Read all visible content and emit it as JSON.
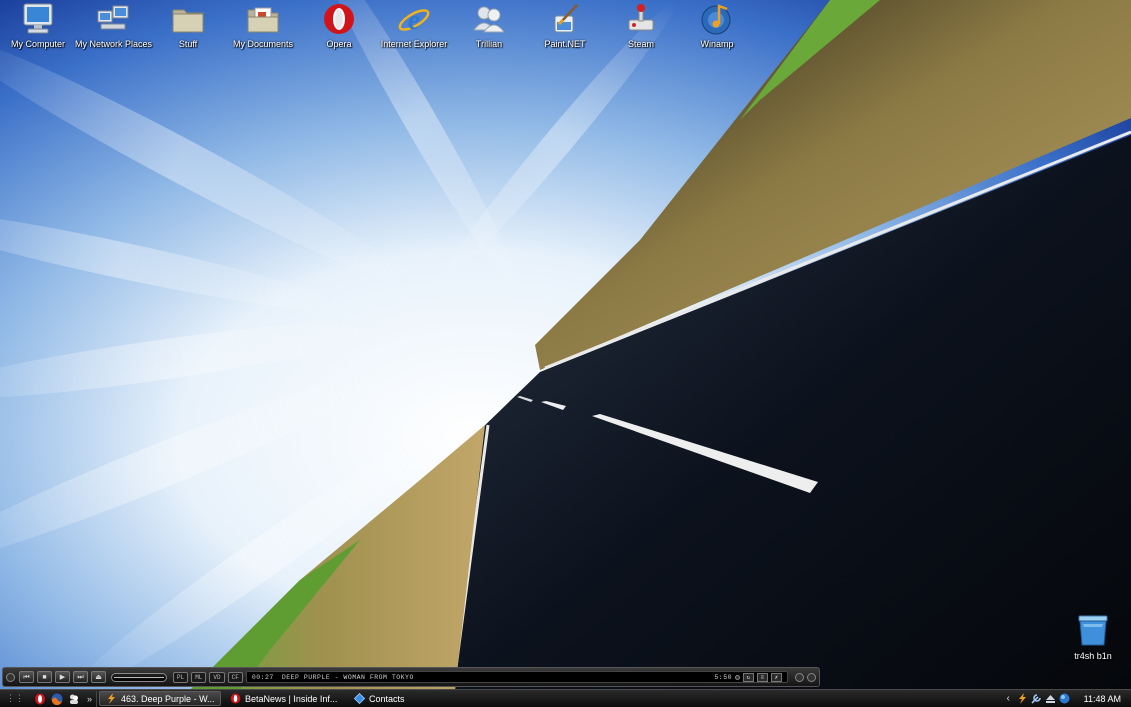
{
  "desktop": {
    "icons": [
      {
        "label": "My Computer"
      },
      {
        "label": "My Network Places"
      },
      {
        "label": "Stuff"
      },
      {
        "label": "My Documents"
      },
      {
        "label": "Opera"
      },
      {
        "label": "Internet Explorer"
      },
      {
        "label": "Trillian"
      },
      {
        "label": "Paint.NET"
      },
      {
        "label": "Steam"
      },
      {
        "label": "Winamp"
      }
    ],
    "trash": {
      "label": "tr4sh b1n"
    }
  },
  "winamp": {
    "buttons": [
      "prev",
      "play",
      "pause",
      "stop",
      "next",
      "eject"
    ],
    "tags": [
      "PL",
      "ML",
      "VD",
      "CF"
    ],
    "time": "00:27",
    "track": "DEEP PURPLE - WOMAN FROM TOKYO",
    "duration": "5:50"
  },
  "taskbar": {
    "tasks": [
      {
        "label": "463. Deep Purple - W..."
      },
      {
        "label": "BetaNews | Inside Inf..."
      },
      {
        "label": "Contacts"
      }
    ],
    "clock": "11:48 AM"
  },
  "colors": {
    "taskbar_bg": "#141414",
    "opera_red": "#d0141a",
    "ie_blue": "#2a78d0",
    "road": "#0b0f18"
  }
}
